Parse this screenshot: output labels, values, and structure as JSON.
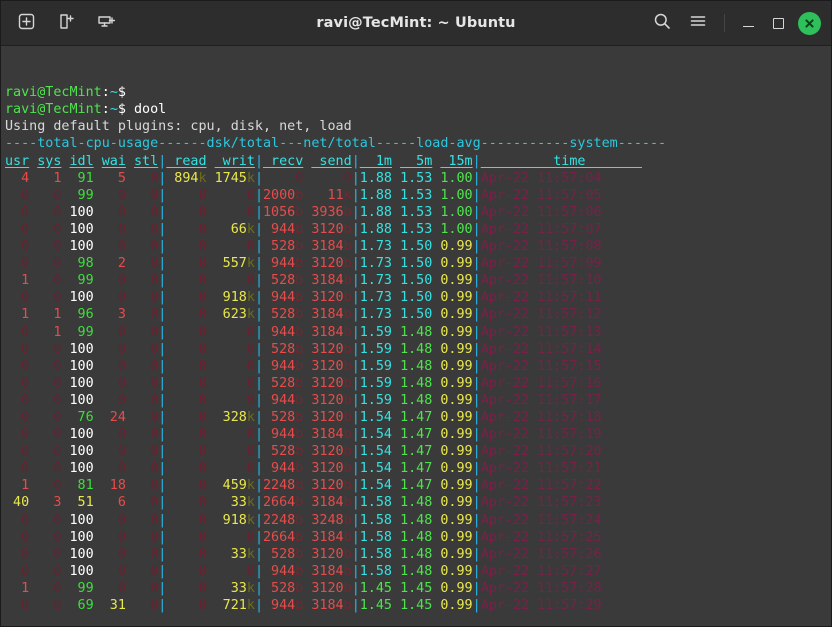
{
  "window": {
    "title": "ravi@TecMint: ~ Ubuntu",
    "left_buttons": [
      {
        "name": "new-tab-button",
        "icon": "plus-in-square-icon"
      },
      {
        "name": "new-window-button",
        "icon": "new-window-icon"
      },
      {
        "name": "new-terminal-button",
        "icon": "screen-plus-icon"
      }
    ],
    "right_buttons": [
      {
        "name": "search-button",
        "icon": "search-icon",
        "label": ""
      },
      {
        "name": "menu-button",
        "icon": "hamburger-icon",
        "label": ""
      },
      {
        "name": "minimize-button",
        "icon": "minimize-icon",
        "label": ""
      },
      {
        "name": "maximize-button",
        "icon": "maximize-icon",
        "label": ""
      },
      {
        "name": "close-button",
        "icon": "close-icon",
        "label": ""
      }
    ],
    "close_color": "#2ec05a",
    "titlebar_bg": "#2d2d2d",
    "terminal_bg": "#3a3a3a"
  },
  "terminal": {
    "prompt": "ravi@TecMint",
    "prompt_path": ":~$",
    "blank_prompt_line": "ravi@TecMint:~$ ",
    "command_line_prompt": "ravi@TecMint:~$ ",
    "command": "dool",
    "plugin_line": "Using default plugins: cpu, disk, net, load",
    "group_header": {
      "cpu": "----total-cpu-usage----",
      "dsk": "-dsk/total-",
      "net": "-net/total-",
      "load": "---load-avg---",
      "sys": "-------system------"
    },
    "columns": {
      "cpu": [
        "usr",
        "sys",
        "idl",
        "wai",
        "stl"
      ],
      "dsk": [
        "read",
        "writ"
      ],
      "net": [
        "recv",
        "send"
      ],
      "load": [
        "1m",
        "5m",
        "15m"
      ],
      "sys": [
        "time"
      ]
    },
    "rows": [
      {
        "usr": "4",
        "sys": "1",
        "idl": "91",
        "wai": "5",
        "stl": "0",
        "read": "894",
        "read_u": "k",
        "writ": "1745",
        "writ_u": "k",
        "recv": "0",
        "recv_u": "",
        "send": "0",
        "send_u": "",
        "m1": "1.88",
        "m5": "1.53",
        "m15": "1.00",
        "date": "Apr-22",
        "time": "11:57:04"
      },
      {
        "usr": "0",
        "sys": "0",
        "idl": "99",
        "wai": "0",
        "stl": "0",
        "read": "0",
        "read_u": "",
        "writ": "0",
        "writ_u": "",
        "recv": "2000",
        "recv_u": "b",
        "send": "11",
        "send_u": "k",
        "m1": "1.88",
        "m5": "1.53",
        "m15": "1.00",
        "date": "Apr-22",
        "time": "11:57:05"
      },
      {
        "usr": "0",
        "sys": "0",
        "idl": "100",
        "wai": "0",
        "stl": "0",
        "read": "0",
        "read_u": "",
        "writ": "0",
        "writ_u": "",
        "recv": "1056",
        "recv_u": "b",
        "send": "3936",
        "send_u": "b",
        "m1": "1.88",
        "m5": "1.53",
        "m15": "1.00",
        "date": "Apr-22",
        "time": "11:57:06"
      },
      {
        "usr": "0",
        "sys": "0",
        "idl": "100",
        "wai": "0",
        "stl": "0",
        "read": "0",
        "read_u": "",
        "writ": "66",
        "writ_u": "k",
        "recv": "944",
        "recv_u": "b",
        "send": "3120",
        "send_u": "b",
        "m1": "1.88",
        "m5": "1.53",
        "m15": "1.00",
        "date": "Apr-22",
        "time": "11:57:07"
      },
      {
        "usr": "0",
        "sys": "0",
        "idl": "100",
        "wai": "0",
        "stl": "0",
        "read": "0",
        "read_u": "",
        "writ": "0",
        "writ_u": "",
        "recv": "528",
        "recv_u": "b",
        "send": "3184",
        "send_u": "b",
        "m1": "1.73",
        "m5": "1.50",
        "m15": "0.99",
        "date": "Apr-22",
        "time": "11:57:08"
      },
      {
        "usr": "0",
        "sys": "0",
        "idl": "98",
        "wai": "2",
        "stl": "0",
        "read": "0",
        "read_u": "",
        "writ": "557",
        "writ_u": "k",
        "recv": "944",
        "recv_u": "b",
        "send": "3120",
        "send_u": "b",
        "m1": "1.73",
        "m5": "1.50",
        "m15": "0.99",
        "date": "Apr-22",
        "time": "11:57:09"
      },
      {
        "usr": "1",
        "sys": "0",
        "idl": "99",
        "wai": "0",
        "stl": "0",
        "read": "0",
        "read_u": "",
        "writ": "0",
        "writ_u": "",
        "recv": "528",
        "recv_u": "b",
        "send": "3184",
        "send_u": "b",
        "m1": "1.73",
        "m5": "1.50",
        "m15": "0.99",
        "date": "Apr-22",
        "time": "11:57:10"
      },
      {
        "usr": "0",
        "sys": "0",
        "idl": "100",
        "wai": "0",
        "stl": "0",
        "read": "0",
        "read_u": "",
        "writ": "918",
        "writ_u": "k",
        "recv": "944",
        "recv_u": "b",
        "send": "3120",
        "send_u": "b",
        "m1": "1.73",
        "m5": "1.50",
        "m15": "0.99",
        "date": "Apr-22",
        "time": "11:57:11"
      },
      {
        "usr": "1",
        "sys": "1",
        "idl": "96",
        "wai": "3",
        "stl": "0",
        "read": "0",
        "read_u": "",
        "writ": "623",
        "writ_u": "k",
        "recv": "528",
        "recv_u": "b",
        "send": "3184",
        "send_u": "b",
        "m1": "1.73",
        "m5": "1.50",
        "m15": "0.99",
        "date": "Apr-22",
        "time": "11:57:12"
      },
      {
        "usr": "0",
        "sys": "1",
        "idl": "99",
        "wai": "0",
        "stl": "0",
        "read": "0",
        "read_u": "",
        "writ": "0",
        "writ_u": "",
        "recv": "944",
        "recv_u": "b",
        "send": "3184",
        "send_u": "b",
        "m1": "1.59",
        "m5": "1.48",
        "m15": "0.99",
        "date": "Apr-22",
        "time": "11:57:13"
      },
      {
        "usr": "0",
        "sys": "0",
        "idl": "100",
        "wai": "0",
        "stl": "0",
        "read": "0",
        "read_u": "",
        "writ": "0",
        "writ_u": "",
        "recv": "528",
        "recv_u": "b",
        "send": "3120",
        "send_u": "b",
        "m1": "1.59",
        "m5": "1.48",
        "m15": "0.99",
        "date": "Apr-22",
        "time": "11:57:14"
      },
      {
        "usr": "0",
        "sys": "0",
        "idl": "100",
        "wai": "0",
        "stl": "0",
        "read": "0",
        "read_u": "",
        "writ": "0",
        "writ_u": "",
        "recv": "944",
        "recv_u": "b",
        "send": "3120",
        "send_u": "b",
        "m1": "1.59",
        "m5": "1.48",
        "m15": "0.99",
        "date": "Apr-22",
        "time": "11:57:15"
      },
      {
        "usr": "0",
        "sys": "0",
        "idl": "100",
        "wai": "0",
        "stl": "0",
        "read": "0",
        "read_u": "",
        "writ": "0",
        "writ_u": "",
        "recv": "528",
        "recv_u": "b",
        "send": "3120",
        "send_u": "b",
        "m1": "1.59",
        "m5": "1.48",
        "m15": "0.99",
        "date": "Apr-22",
        "time": "11:57:16"
      },
      {
        "usr": "0",
        "sys": "0",
        "idl": "100",
        "wai": "0",
        "stl": "0",
        "read": "0",
        "read_u": "",
        "writ": "0",
        "writ_u": "",
        "recv": "944",
        "recv_u": "b",
        "send": "3120",
        "send_u": "b",
        "m1": "1.59",
        "m5": "1.48",
        "m15": "0.99",
        "date": "Apr-22",
        "time": "11:57:17"
      },
      {
        "usr": "0",
        "sys": "0",
        "idl": "76",
        "wai": "24",
        "stl": "0",
        "read": "0",
        "read_u": "",
        "writ": "328",
        "writ_u": "k",
        "recv": "528",
        "recv_u": "b",
        "send": "3120",
        "send_u": "b",
        "m1": "1.54",
        "m5": "1.47",
        "m15": "0.99",
        "date": "Apr-22",
        "time": "11:57:18"
      },
      {
        "usr": "0",
        "sys": "0",
        "idl": "100",
        "wai": "0",
        "stl": "0",
        "read": "0",
        "read_u": "",
        "writ": "0",
        "writ_u": "",
        "recv": "944",
        "recv_u": "b",
        "send": "3184",
        "send_u": "b",
        "m1": "1.54",
        "m5": "1.47",
        "m15": "0.99",
        "date": "Apr-22",
        "time": "11:57:19"
      },
      {
        "usr": "0",
        "sys": "0",
        "idl": "100",
        "wai": "0",
        "stl": "0",
        "read": "0",
        "read_u": "",
        "writ": "0",
        "writ_u": "",
        "recv": "528",
        "recv_u": "b",
        "send": "3120",
        "send_u": "b",
        "m1": "1.54",
        "m5": "1.47",
        "m15": "0.99",
        "date": "Apr-22",
        "time": "11:57:20"
      },
      {
        "usr": "0",
        "sys": "0",
        "idl": "100",
        "wai": "0",
        "stl": "0",
        "read": "0",
        "read_u": "",
        "writ": "0",
        "writ_u": "",
        "recv": "944",
        "recv_u": "b",
        "send": "3120",
        "send_u": "b",
        "m1": "1.54",
        "m5": "1.47",
        "m15": "0.99",
        "date": "Apr-22",
        "time": "11:57:21"
      },
      {
        "usr": "1",
        "sys": "0",
        "idl": "81",
        "wai": "18",
        "stl": "0",
        "read": "0",
        "read_u": "",
        "writ": "459",
        "writ_u": "k",
        "recv": "2248",
        "recv_u": "b",
        "send": "3120",
        "send_u": "b",
        "m1": "1.54",
        "m5": "1.47",
        "m15": "0.99",
        "date": "Apr-22",
        "time": "11:57:22"
      },
      {
        "usr": "40",
        "sys": "3",
        "idl": "51",
        "wai": "6",
        "stl": "0",
        "read": "0",
        "read_u": "",
        "writ": "33",
        "writ_u": "k",
        "recv": "2664",
        "recv_u": "b",
        "send": "3184",
        "send_u": "b",
        "m1": "1.58",
        "m5": "1.48",
        "m15": "0.99",
        "date": "Apr-22",
        "time": "11:57:23"
      },
      {
        "usr": "0",
        "sys": "0",
        "idl": "100",
        "wai": "0",
        "stl": "0",
        "read": "0",
        "read_u": "",
        "writ": "918",
        "writ_u": "k",
        "recv": "2248",
        "recv_u": "b",
        "send": "3248",
        "send_u": "b",
        "m1": "1.58",
        "m5": "1.48",
        "m15": "0.99",
        "date": "Apr-22",
        "time": "11:57:24"
      },
      {
        "usr": "0",
        "sys": "0",
        "idl": "100",
        "wai": "0",
        "stl": "0",
        "read": "0",
        "read_u": "",
        "writ": "0",
        "writ_u": "",
        "recv": "2664",
        "recv_u": "b",
        "send": "3184",
        "send_u": "b",
        "m1": "1.58",
        "m5": "1.48",
        "m15": "0.99",
        "date": "Apr-22",
        "time": "11:57:25"
      },
      {
        "usr": "0",
        "sys": "0",
        "idl": "100",
        "wai": "0",
        "stl": "0",
        "read": "0",
        "read_u": "",
        "writ": "33",
        "writ_u": "k",
        "recv": "528",
        "recv_u": "b",
        "send": "3120",
        "send_u": "b",
        "m1": "1.58",
        "m5": "1.48",
        "m15": "0.99",
        "date": "Apr-22",
        "time": "11:57:26"
      },
      {
        "usr": "0",
        "sys": "0",
        "idl": "100",
        "wai": "0",
        "stl": "0",
        "read": "0",
        "read_u": "",
        "writ": "0",
        "writ_u": "",
        "recv": "944",
        "recv_u": "b",
        "send": "3184",
        "send_u": "b",
        "m1": "1.58",
        "m5": "1.48",
        "m15": "0.99",
        "date": "Apr-22",
        "time": "11:57:27"
      },
      {
        "usr": "1",
        "sys": "0",
        "idl": "99",
        "wai": "0",
        "stl": "0",
        "read": "0",
        "read_u": "",
        "writ": "33",
        "writ_u": "k",
        "recv": "528",
        "recv_u": "b",
        "send": "3120",
        "send_u": "b",
        "m1": "1.45",
        "m5": "1.45",
        "m15": "0.99",
        "date": "Apr-22",
        "time": "11:57:28"
      },
      {
        "usr": "0",
        "sys": "0",
        "idl": "69",
        "wai": "31",
        "stl": "0",
        "read": "0",
        "read_u": "",
        "writ": "721",
        "writ_u": "k",
        "recv": "944",
        "recv_u": "b",
        "send": "3184",
        "send_u": "b",
        "m1": "1.45",
        "m5": "1.45",
        "m15": "0.99",
        "date": "Apr-22",
        "time": "11:57:29"
      }
    ]
  },
  "colors": {
    "prompt_green": "#4ee44e",
    "header_cyan": "#2bc8e0",
    "bar_cyan": "#29b6e8",
    "idle_green": "#3ae03a",
    "idle_white": "#ffffff",
    "busy_red": "#e84b4b",
    "zero_dim": "#5c1f2a",
    "unit_yellow": "#e8e84b",
    "time_magenta": "#7a2048",
    "terminal_bg": "#3a3a3a"
  }
}
